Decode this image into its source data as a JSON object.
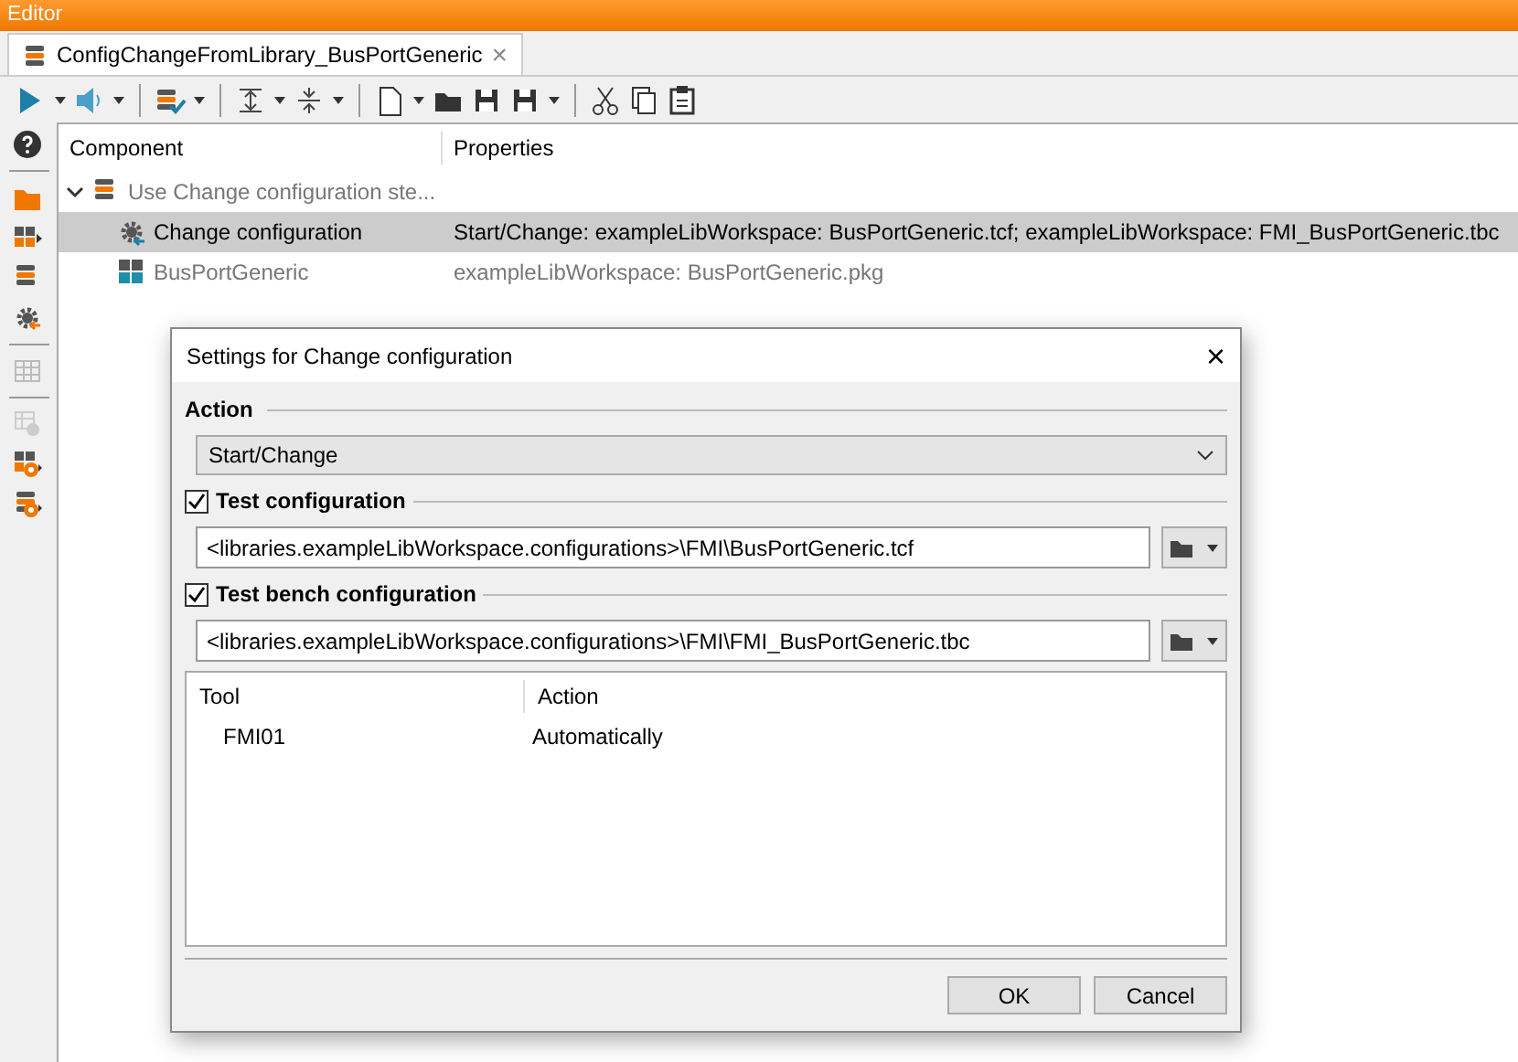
{
  "window": {
    "title": "Editor"
  },
  "tabs": [
    {
      "label": "ConfigChangeFromLibrary_BusPortGeneric",
      "selected": true,
      "close": "×"
    }
  ],
  "tree": {
    "columns": [
      "Component",
      "Properties"
    ],
    "rows": [
      {
        "kind": "sequence",
        "label": "Use Change configuration ste...",
        "properties": "",
        "expanded": true,
        "selected": false,
        "children": [
          {
            "kind": "change",
            "label": "Change configuration",
            "properties": "Start/Change: exampleLibWorkspace: BusPortGeneric.tcf; exampleLibWorkspace: FMI_BusPortGeneric.tbc",
            "selected": true
          },
          {
            "kind": "package",
            "label": "BusPortGeneric",
            "properties": "exampleLibWorkspace: BusPortGeneric.pkg",
            "selected": false
          }
        ]
      }
    ]
  },
  "dialog": {
    "title": "Settings for Change configuration",
    "close": "×",
    "action": {
      "label": "Action",
      "value": "Start/Change"
    },
    "configs": [
      {
        "label": "Test configuration",
        "checked": true,
        "path": "<libraries.exampleLibWorkspace.configurations>\\FMI\\BusPortGeneric.tcf"
      },
      {
        "label": "Test bench configuration",
        "checked": true,
        "path": "<libraries.exampleLibWorkspace.configurations>\\FMI\\FMI_BusPortGeneric.tbc"
      }
    ],
    "table": {
      "columns": [
        "Tool",
        "Action"
      ],
      "rows": [
        [
          "FMI01",
          "Automatically"
        ]
      ]
    },
    "buttons": [
      "OK",
      "Cancel"
    ]
  }
}
